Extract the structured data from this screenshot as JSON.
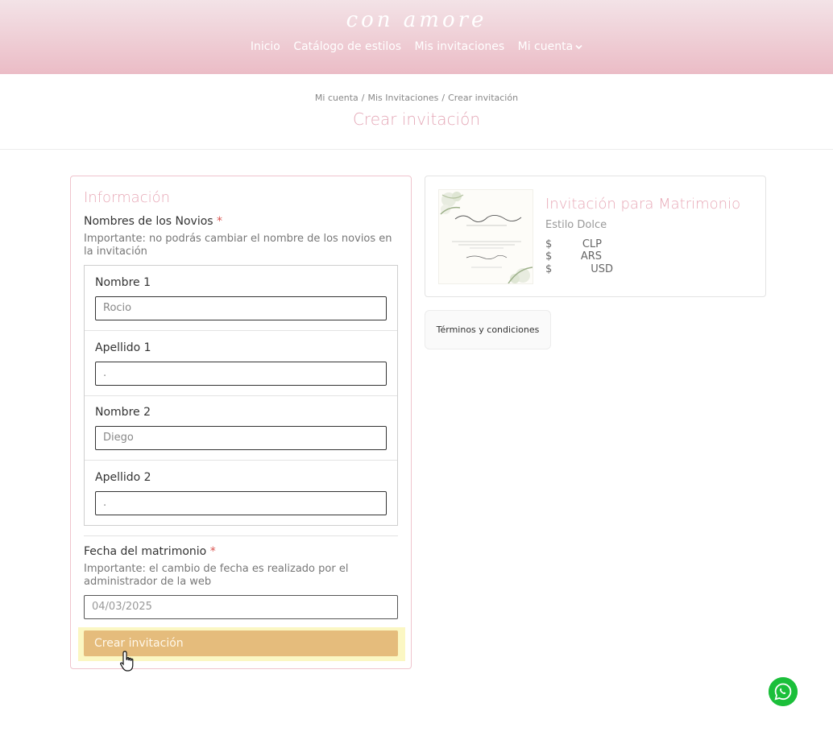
{
  "header": {
    "logo": "con amore",
    "nav": [
      {
        "label": "Inicio"
      },
      {
        "label": "Catálogo de estilos"
      },
      {
        "label": "Mis invitaciones"
      },
      {
        "label": "Mi cuenta"
      }
    ]
  },
  "breadcrumb": [
    "Mi cuenta",
    "Mis Invitaciones",
    "Crear invitación"
  ],
  "page_title": "Crear invitación",
  "form": {
    "section_title": "Información",
    "names_label": "Nombres de los Novios",
    "required_mark": "*",
    "names_help": "Importante: no podrás cambiar el nombre de los novios en la invitación",
    "fields": [
      {
        "label": "Nombre 1",
        "value": "Rocio"
      },
      {
        "label": "Apellido 1",
        "value": "."
      },
      {
        "label": "Nombre 2",
        "value": "Diego"
      },
      {
        "label": "Apellido 2",
        "value": "."
      }
    ],
    "date_label": "Fecha del matrimonio",
    "date_help": "Importante: el cambio de fecha es realizado por el administrador de la web",
    "date_value": "04/03/2025",
    "submit_label": "Crear invitación"
  },
  "product": {
    "title": "Invitación para Matrimonio",
    "style": "Estilo Dolce",
    "prices": [
      {
        "symbol": "$",
        "currency": "CLP"
      },
      {
        "symbol": "$",
        "currency": "ARS"
      },
      {
        "symbol": "$",
        "currency": "USD"
      }
    ]
  },
  "terms_label": "Términos y condiciones",
  "colors": {
    "accent_pink": "#e8a9b7",
    "button_gold": "#e5bc7c",
    "whatsapp_green": "#1bbf3a"
  }
}
